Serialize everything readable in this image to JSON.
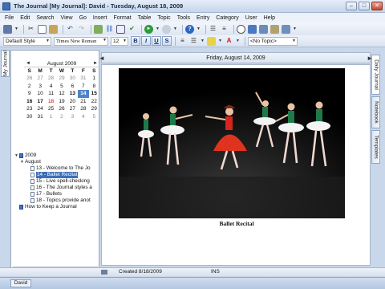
{
  "window": {
    "title": "The Journal [My Journal]: David - Tuesday, August 18, 2009",
    "controls": {
      "minimize": "–",
      "maximize": "□",
      "close": "✕"
    }
  },
  "menu": [
    "File",
    "Edit",
    "Search",
    "View",
    "Go",
    "Insert",
    "Format",
    "Table",
    "Topic",
    "Tools",
    "Entry",
    "Category",
    "User",
    "Help"
  ],
  "format_bar": {
    "style": "Default Style",
    "font": "Times New Roman",
    "size": "12",
    "bold": "B",
    "italic": "I",
    "underline": "U",
    "strike": "S",
    "topic": "<No Topic>"
  },
  "left_tab": "My Journal",
  "calendar": {
    "month": "August 2009",
    "prev": "◄",
    "next": "►",
    "day_names": [
      "S",
      "M",
      "T",
      "W",
      "T",
      "F",
      "S"
    ],
    "weeks": [
      [
        {
          "d": "26",
          "other": true
        },
        {
          "d": "27",
          "other": true
        },
        {
          "d": "28",
          "other": true
        },
        {
          "d": "29",
          "other": true
        },
        {
          "d": "30",
          "other": true
        },
        {
          "d": "31",
          "other": true
        },
        {
          "d": "1"
        }
      ],
      [
        {
          "d": "2"
        },
        {
          "d": "3"
        },
        {
          "d": "4"
        },
        {
          "d": "5"
        },
        {
          "d": "6"
        },
        {
          "d": "7"
        },
        {
          "d": "8"
        }
      ],
      [
        {
          "d": "9"
        },
        {
          "d": "10"
        },
        {
          "d": "11"
        },
        {
          "d": "12"
        },
        {
          "d": "13",
          "bold": true
        },
        {
          "d": "14",
          "bold": true,
          "selected": true
        },
        {
          "d": "15",
          "bold": true
        }
      ],
      [
        {
          "d": "16",
          "bold": true
        },
        {
          "d": "17",
          "bold": true
        },
        {
          "d": "18",
          "red": true
        },
        {
          "d": "19"
        },
        {
          "d": "20"
        },
        {
          "d": "21"
        },
        {
          "d": "22"
        }
      ],
      [
        {
          "d": "23"
        },
        {
          "d": "24"
        },
        {
          "d": "25"
        },
        {
          "d": "26"
        },
        {
          "d": "27"
        },
        {
          "d": "28"
        },
        {
          "d": "29"
        }
      ],
      [
        {
          "d": "30"
        },
        {
          "d": "31"
        },
        {
          "d": "1",
          "other": true
        },
        {
          "d": "2",
          "other": true
        },
        {
          "d": "3",
          "other": true
        },
        {
          "d": "4",
          "other": true
        },
        {
          "d": "5",
          "other": true
        }
      ]
    ]
  },
  "tree": [
    {
      "label": "2009",
      "level": 0,
      "kind": "book",
      "twisty": "▼"
    },
    {
      "label": "August",
      "level": 1,
      "kind": "none",
      "twisty": "▼"
    },
    {
      "label": "13 - Welcome to The Jo",
      "level": 2,
      "kind": "page"
    },
    {
      "label": "14 - Ballet Recital",
      "level": 2,
      "kind": "page",
      "selected": true
    },
    {
      "label": "15 - Live spell-checking",
      "level": 2,
      "kind": "page"
    },
    {
      "label": "16 - The Journal styles a",
      "level": 2,
      "kind": "page"
    },
    {
      "label": "17 - Bullets",
      "level": 2,
      "kind": "page"
    },
    {
      "label": "18 - Topics provide anot",
      "level": 2,
      "kind": "page"
    },
    {
      "label": "How to Keep a Journal",
      "level": 0,
      "kind": "book"
    }
  ],
  "entry": {
    "date": "Friday, August 14, 2009",
    "nav_prev": "◄",
    "nav_next": "►",
    "caption": "Ballet Recital"
  },
  "right_tabs": [
    "Daily Journal",
    "Notebook",
    "Templates"
  ],
  "status": {
    "created": "Created 8/18/2009",
    "mode": "INS"
  },
  "taskbar": {
    "user": "David"
  }
}
